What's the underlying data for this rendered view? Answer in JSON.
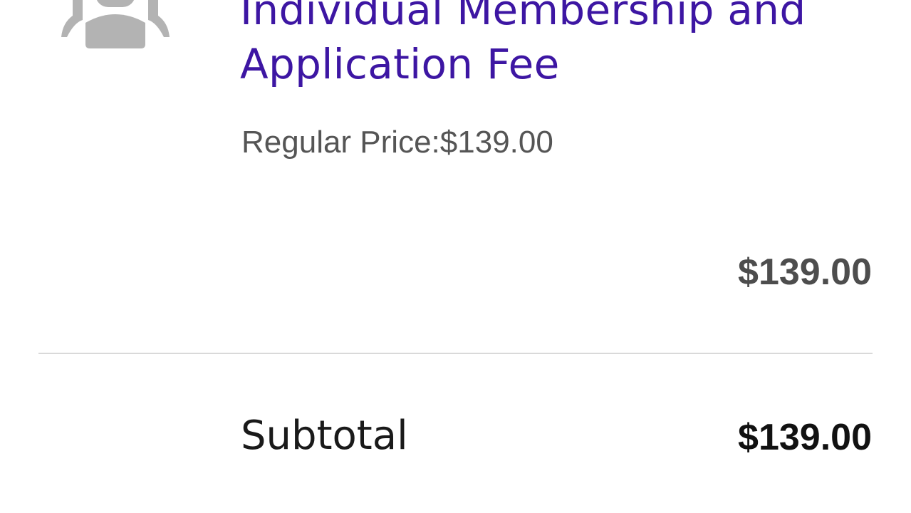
{
  "cart_item": {
    "icon": "user-group-icon",
    "title": "Individual Membership and Application Fee",
    "regular_price": "Regular Price:$139.00",
    "line_total": "$139.00"
  },
  "summary": {
    "subtotal_label": "Subtotal",
    "subtotal_value": "$139.00"
  },
  "colors": {
    "title": "#3d16a3",
    "icon": "#b3b3b3",
    "divider": "#d9d9d9"
  }
}
